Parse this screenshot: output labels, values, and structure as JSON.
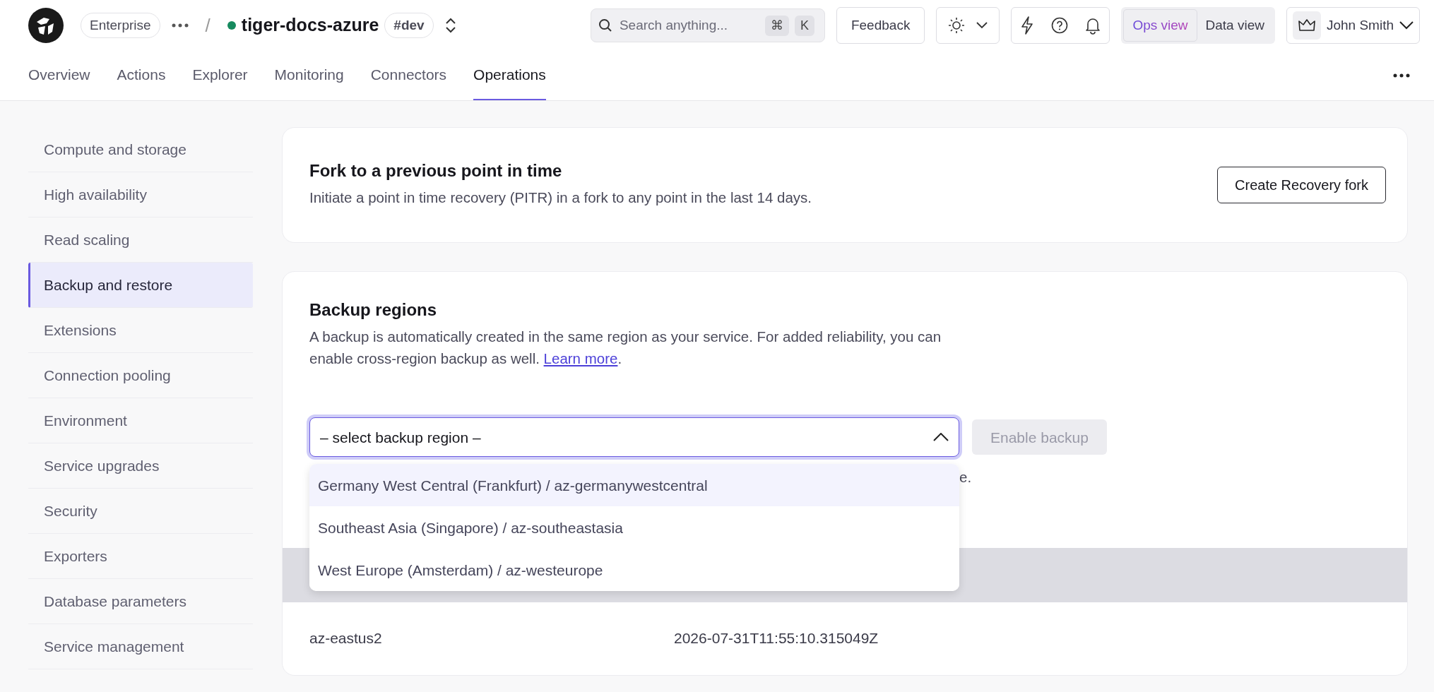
{
  "header": {
    "org_badge": "Enterprise",
    "separator": "/",
    "service_name": "tiger-docs-azure",
    "tag": "#dev"
  },
  "search": {
    "placeholder": "Search anything...",
    "keys": [
      "⌘",
      "K"
    ]
  },
  "feedback_button": "Feedback",
  "view_toggle": [
    {
      "label": "Ops view",
      "selected": true
    },
    {
      "label": "Data view",
      "selected": false
    }
  ],
  "user": {
    "name": "John Smith"
  },
  "tabs": [
    {
      "label": "Overview",
      "selected": false
    },
    {
      "label": "Actions",
      "selected": false
    },
    {
      "label": "Explorer",
      "selected": false
    },
    {
      "label": "Monitoring",
      "selected": false
    },
    {
      "label": "Connectors",
      "selected": false
    },
    {
      "label": "Operations",
      "selected": true
    }
  ],
  "sidebar": {
    "items": [
      {
        "label": "Compute and storage",
        "selected": false
      },
      {
        "label": "High availability",
        "selected": false
      },
      {
        "label": "Read scaling",
        "selected": false
      },
      {
        "label": "Backup and restore",
        "selected": true
      },
      {
        "label": "Extensions",
        "selected": false
      },
      {
        "label": "Connection pooling",
        "selected": false
      },
      {
        "label": "Environment",
        "selected": false
      },
      {
        "label": "Service upgrades",
        "selected": false
      },
      {
        "label": "Security",
        "selected": false
      },
      {
        "label": "Exporters",
        "selected": false
      },
      {
        "label": "Database parameters",
        "selected": false
      },
      {
        "label": "Service management",
        "selected": false
      }
    ]
  },
  "fork_card": {
    "title": "Fork to a previous point in time",
    "description": "Initiate a point in time recovery (PITR) in a fork to any point in the last 14 days.",
    "button": "Create Recovery fork"
  },
  "backup_card": {
    "title": "Backup regions",
    "description_before": "A backup is automatically created in the same region as your service. For added reliability, you can enable cross-region backup as well. ",
    "link": "Learn more",
    "description_after": ".",
    "select": {
      "placeholder": "– select backup region –",
      "expanded": true,
      "options": [
        {
          "label": "Germany West Central (Frankfurt) / az-germanywestcentral",
          "highlighted": true
        },
        {
          "label": "Southeast Asia (Singapore) / az-southeastasia",
          "highlighted": false
        },
        {
          "label": "West Europe (Amsterdam) / az-westeurope",
          "highlighted": false
        }
      ]
    },
    "enable_button": {
      "label": "Enable backup",
      "disabled": true
    },
    "note_visible": "e.",
    "table": {
      "rows": [
        [
          "az-eastus2",
          "2026-07-31T11:55:10.315049Z"
        ]
      ]
    }
  }
}
